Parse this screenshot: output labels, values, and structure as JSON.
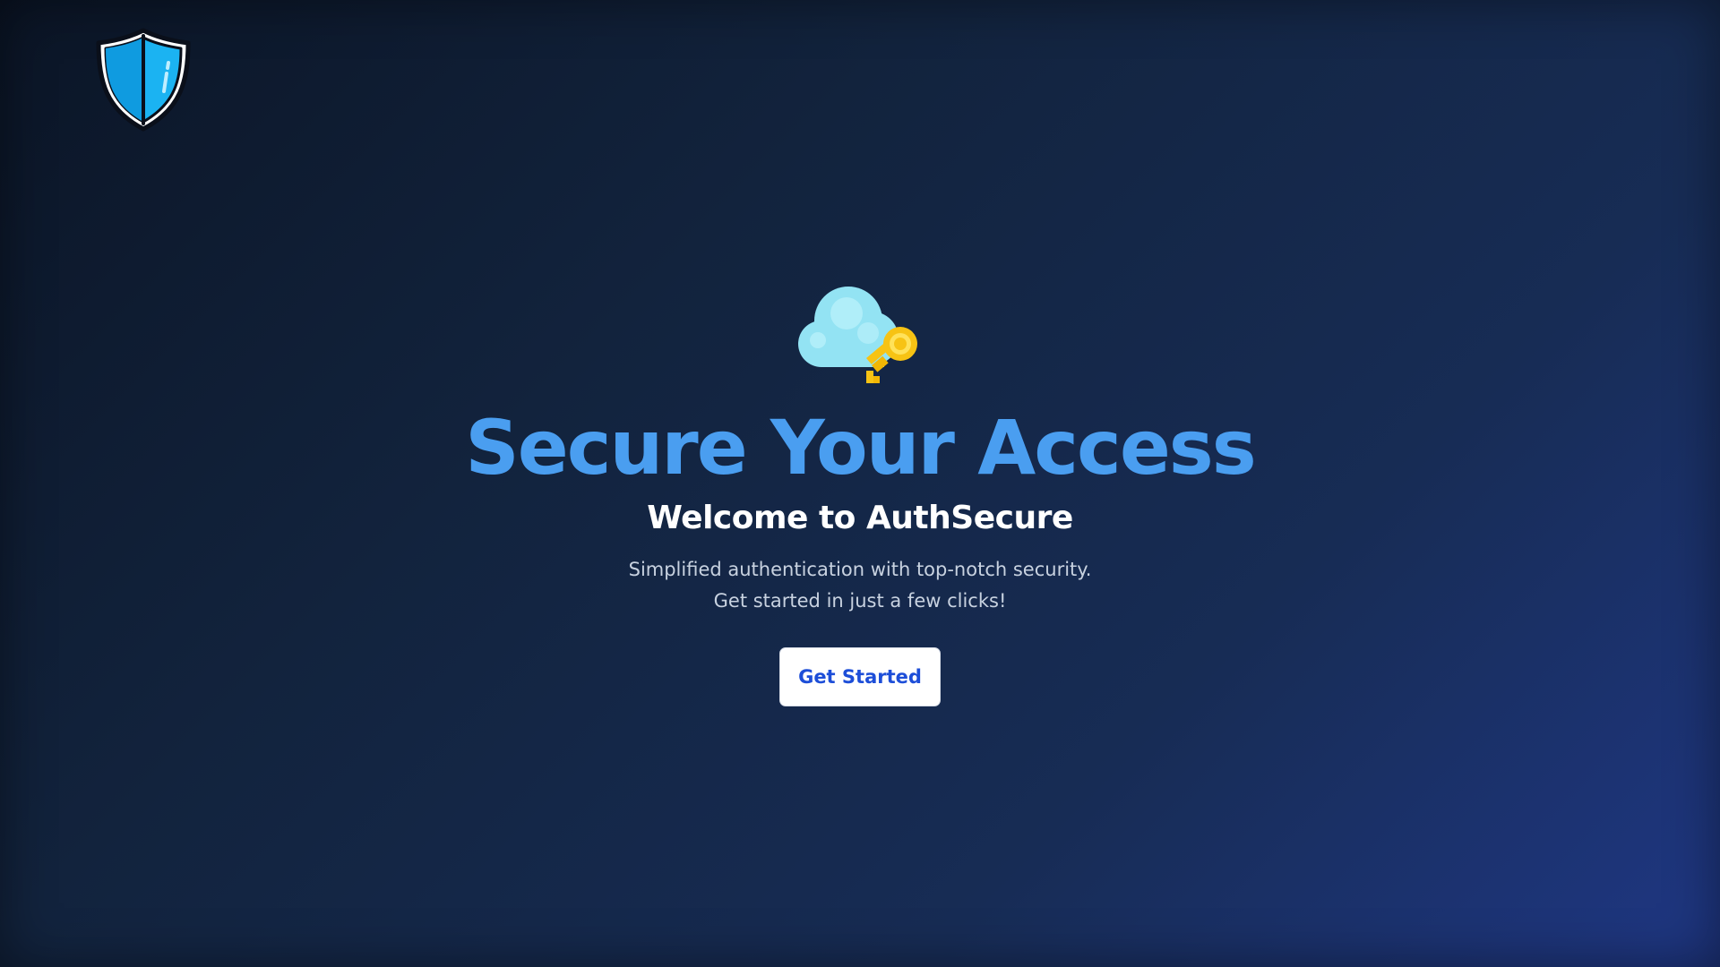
{
  "brand": {
    "logo_icon": "shield-icon",
    "shield_color": "#1bb3f2"
  },
  "hero": {
    "icon": "cloud-key-icon",
    "title": "Secure Your Access",
    "subtitle": "Welcome to AuthSecure",
    "description": "Simplified authentication with top-notch security. Get started in just a few clicks!",
    "cta_label": "Get Started"
  },
  "colors": {
    "title": "#4a9ef0",
    "cta_text": "#1d4ed8",
    "background_start": "#0b1526",
    "background_end": "#1f3784"
  }
}
